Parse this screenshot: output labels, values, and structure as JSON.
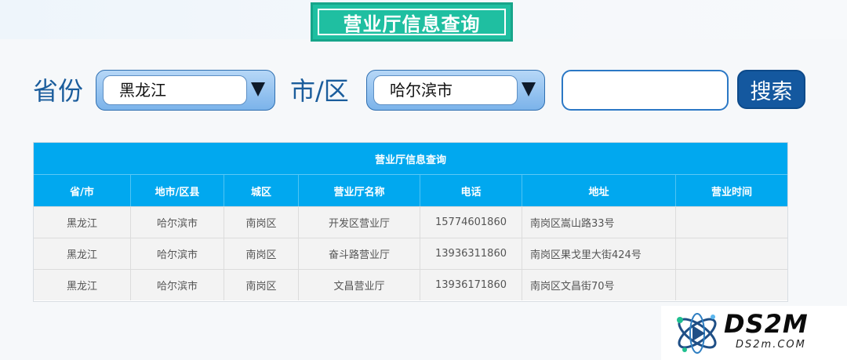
{
  "banner": {
    "title": "营业厅信息查询"
  },
  "filters": {
    "province_label": "省份",
    "province_value": "黑龙江",
    "city_label": "市/区",
    "city_value": "哈尔滨市",
    "search_value": "",
    "search_button": "搜索"
  },
  "table": {
    "caption": "营业厅信息查询",
    "headers": [
      "省/市",
      "地市/区县",
      "城区",
      "营业厅名称",
      "电话",
      "地址",
      "营业时间"
    ],
    "rows": [
      [
        "黑龙江",
        "哈尔滨市",
        "南岗区",
        "开发区营业厅",
        "15774601860",
        "南岗区嵩山路33号",
        ""
      ],
      [
        "黑龙江",
        "哈尔滨市",
        "南岗区",
        "奋斗路营业厅",
        "13936311860",
        "南岗区果戈里大街424号",
        ""
      ],
      [
        "黑龙江",
        "哈尔滨市",
        "南岗区",
        "文昌营业厅",
        "13936171860",
        "南岗区文昌街70号",
        ""
      ]
    ]
  },
  "watermark": {
    "main": "DS2M",
    "sub": "DS2m.COM"
  },
  "icons": {
    "select_arrow": "triangle-down-icon",
    "watermark_logo": "atom-logo-icon"
  },
  "colors": {
    "accent": "#01a8ef",
    "button": "#14589f",
    "banner": "#1fbfa1"
  }
}
